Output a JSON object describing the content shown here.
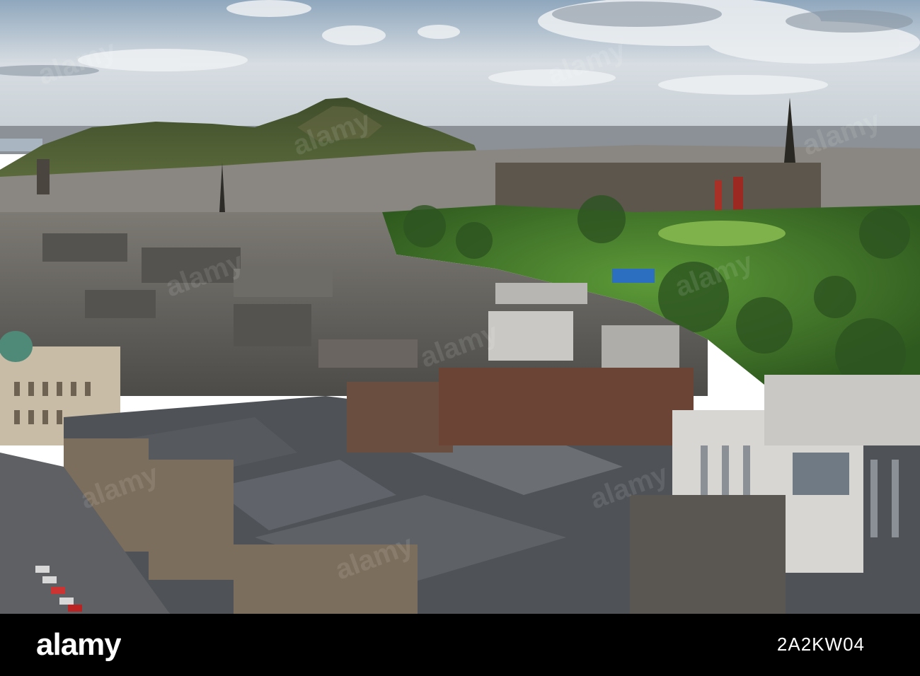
{
  "photo": {
    "subject": "aerial-city-view",
    "watermark_repeats": [
      "alamy",
      "alamy",
      "alamy",
      "alamy",
      "alamy",
      "alamy",
      "alamy",
      "alamy",
      "alamy",
      "alamy"
    ]
  },
  "banner": {
    "logo": "alamy",
    "image_id": "2A2KW04"
  },
  "colors": {
    "banner_bg": "#000000",
    "banner_text": "#ffffff",
    "sky": "#c9d3db",
    "hill": "#4b5a34",
    "park": "#3e6b2a",
    "roofs": "#5b5e63",
    "stone": "#8a7b67"
  }
}
